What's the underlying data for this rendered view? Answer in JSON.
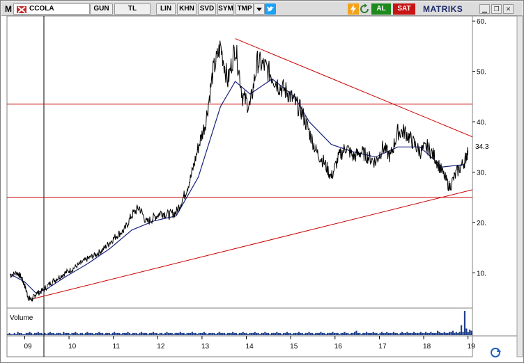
{
  "toolbar": {
    "menu_letter": "M",
    "symbol": "CCOLA",
    "period": "GUN",
    "currency": "TL",
    "buttons": [
      "LIN",
      "KHN",
      "SVD",
      "SYM",
      "TMP"
    ],
    "buy_label": "AL",
    "sell_label": "SAT",
    "brand": "MATRIKS",
    "icons": [
      "twitter-icon",
      "lightning-icon",
      "refresh-icon"
    ],
    "window_controls": [
      "minimize",
      "restore",
      "close"
    ],
    "colors": {
      "buy": "#1e8a1e",
      "sell": "#c81414",
      "brand": "#1b2a6b"
    }
  },
  "chart_data": {
    "type": "line",
    "series": [
      {
        "name": "",
        "color": "#000000"
      },
      {
        "name": "",
        "color": "#1a237e"
      }
    ],
    "x_ticks": [
      "09",
      "10",
      "11",
      "12",
      "13",
      "14",
      "15",
      "16",
      "17",
      "18",
      "19"
    ],
    "y_ticks": [
      "10.",
      "20.",
      "30.",
      "40.",
      "50.",
      "60."
    ],
    "ylim": [
      3,
      61
    ],
    "last_price": "34.3",
    "close": [
      [
        "2008-09",
        9.5
      ],
      [
        "2008-11",
        10.0
      ],
      [
        "2008-12",
        9.2
      ],
      [
        "2009-01",
        7.5
      ],
      [
        "2009-02",
        5.0
      ],
      [
        "2009-03",
        4.7
      ],
      [
        "2009-04",
        5.8
      ],
      [
        "2009-06",
        6.5
      ],
      [
        "2009-08",
        8.0
      ],
      [
        "2009-10",
        9.0
      ],
      [
        "2009-12",
        10.0
      ],
      [
        "2010-02",
        10.8
      ],
      [
        "2010-04",
        11.8
      ],
      [
        "2010-06",
        12.8
      ],
      [
        "2010-08",
        13.5
      ],
      [
        "2010-10",
        14.5
      ],
      [
        "2010-12",
        16.0
      ],
      [
        "2011-02",
        17.5
      ],
      [
        "2011-04",
        18.5
      ],
      [
        "2011-06",
        21.5
      ],
      [
        "2011-08",
        23.0
      ],
      [
        "2011-10",
        20.0
      ],
      [
        "2011-12",
        21.0
      ],
      [
        "2012-02",
        22.0
      ],
      [
        "2012-04",
        21.5
      ],
      [
        "2012-06",
        22.0
      ],
      [
        "2012-08",
        25.0
      ],
      [
        "2012-10",
        29.0
      ],
      [
        "2012-12",
        35.0
      ],
      [
        "2013-02",
        40.0
      ],
      [
        "2013-04",
        50.0
      ],
      [
        "2013-06",
        55.0
      ],
      [
        "2013-08",
        48.0
      ],
      [
        "2013-10",
        55.0
      ],
      [
        "2013-12",
        45.0
      ],
      [
        "2014-02",
        43.0
      ],
      [
        "2014-04",
        52.0
      ],
      [
        "2014-06",
        51.0
      ],
      [
        "2014-08",
        49.0
      ],
      [
        "2014-10",
        47.0
      ],
      [
        "2014-12",
        46.0
      ],
      [
        "2015-02",
        44.0
      ],
      [
        "2015-04",
        42.0
      ],
      [
        "2015-06",
        38.0
      ],
      [
        "2015-08",
        34.0
      ],
      [
        "2015-10",
        32.0
      ],
      [
        "2015-12",
        29.0
      ],
      [
        "2016-02",
        33.0
      ],
      [
        "2016-04",
        35.0
      ],
      [
        "2016-06",
        33.0
      ],
      [
        "2016-08",
        34.0
      ],
      [
        "2016-10",
        33.0
      ],
      [
        "2016-12",
        32.0
      ],
      [
        "2017-02",
        35.0
      ],
      [
        "2017-04",
        33.0
      ],
      [
        "2017-06",
        38.0
      ],
      [
        "2017-08",
        38.0
      ],
      [
        "2017-10",
        36.0
      ],
      [
        "2017-12",
        34.0
      ],
      [
        "2018-02",
        35.0
      ],
      [
        "2018-04",
        33.0
      ],
      [
        "2018-06",
        30.0
      ],
      [
        "2018-08",
        27.0
      ],
      [
        "2018-10",
        30.0
      ],
      [
        "2018-12",
        32.0
      ],
      [
        "2019-01",
        34.3
      ]
    ],
    "moving_average": [
      [
        "2008-09",
        9.8
      ],
      [
        "2009-01",
        8.2
      ],
      [
        "2009-04",
        6.0
      ],
      [
        "2009-07",
        6.8
      ],
      [
        "2009-12",
        9.2
      ],
      [
        "2010-06",
        11.8
      ],
      [
        "2010-12",
        14.8
      ],
      [
        "2011-06",
        18.5
      ],
      [
        "2011-12",
        20.3
      ],
      [
        "2012-06",
        21.3
      ],
      [
        "2012-12",
        29.0
      ],
      [
        "2013-06",
        43.0
      ],
      [
        "2013-10",
        48.0
      ],
      [
        "2014-02",
        45.5
      ],
      [
        "2014-08",
        48.5
      ],
      [
        "2015-02",
        45.0
      ],
      [
        "2015-06",
        40.0
      ],
      [
        "2015-12",
        35.5
      ],
      [
        "2016-06",
        34.0
      ],
      [
        "2016-12",
        33.0
      ],
      [
        "2017-06",
        35.0
      ],
      [
        "2017-12",
        35.0
      ],
      [
        "2018-06",
        31.0
      ],
      [
        "2018-12",
        31.5
      ]
    ],
    "horizontal_lines": [
      {
        "value": 43.5,
        "color": "#cc0000"
      },
      {
        "value": 25.0,
        "color": "#cc0000"
      }
    ],
    "trend_lines": [
      {
        "from": [
          "2009-03",
          4.8
        ],
        "to": [
          "2019-03",
          26.5
        ],
        "color": "#cc0000"
      },
      {
        "from": [
          "2013-10",
          56.5
        ],
        "to": [
          "2019-03",
          37.0
        ],
        "color": "#cc0000"
      }
    ],
    "volume": {
      "label": "Volume",
      "color": "#1f3e8a",
      "values": [
        1,
        2,
        1,
        1,
        2,
        1,
        3,
        2,
        2,
        1,
        1,
        2,
        2,
        3,
        2,
        1,
        2,
        2,
        3,
        2,
        2,
        1,
        2,
        1,
        2,
        3,
        2,
        2,
        1,
        2,
        2,
        2,
        1,
        3,
        2,
        2,
        2,
        1,
        2,
        2,
        3,
        2,
        1,
        2,
        2,
        1,
        2,
        3,
        2,
        2,
        2,
        1,
        2,
        2,
        3,
        2,
        2,
        1,
        2,
        2,
        2,
        1,
        2,
        3,
        2,
        2,
        2,
        1,
        2,
        2,
        2,
        3,
        2,
        1,
        2,
        2,
        2,
        1,
        2,
        3,
        2,
        2,
        2,
        1,
        2,
        2,
        3,
        2,
        2,
        1,
        2,
        2,
        1,
        2,
        3,
        2,
        2,
        2,
        1,
        2,
        2,
        2,
        3,
        2,
        2,
        1,
        2,
        2,
        2,
        3,
        2,
        2,
        1,
        2,
        2,
        2,
        3,
        2,
        1,
        2,
        2,
        2,
        2,
        1,
        2,
        3,
        2,
        2,
        2,
        1,
        2,
        2,
        2,
        3,
        2,
        2,
        1,
        2,
        2,
        3,
        2,
        2,
        1,
        2,
        2,
        2,
        3,
        2,
        2,
        1,
        2,
        2,
        3,
        2,
        2,
        1,
        2,
        2,
        2,
        3,
        2,
        2,
        1,
        2,
        2,
        3,
        2,
        2,
        1,
        2,
        2,
        2,
        3,
        2,
        2,
        1,
        2,
        2,
        3,
        2,
        2,
        1,
        2,
        2,
        2,
        3,
        2,
        2,
        1,
        2,
        2,
        2,
        3,
        2,
        2,
        2,
        1,
        2,
        2,
        3,
        2,
        2,
        1,
        2,
        2,
        3,
        4,
        2,
        2,
        1,
        2,
        2,
        3,
        2,
        2,
        2,
        3,
        2,
        2,
        1,
        2,
        3,
        2,
        2,
        3,
        2,
        2,
        2,
        3,
        2,
        2,
        1,
        2,
        3,
        2,
        2,
        3,
        2,
        2,
        2,
        3,
        2,
        2,
        2,
        3,
        2,
        2,
        3,
        2,
        2,
        3,
        2,
        2,
        2,
        4,
        3,
        2,
        2,
        3,
        2,
        2,
        3,
        3,
        4,
        2,
        3,
        2,
        3,
        9,
        3,
        22,
        6,
        3,
        5,
        4
      ],
      "ylim": [
        0,
        22
      ]
    },
    "grid": "off",
    "legend": "none"
  }
}
